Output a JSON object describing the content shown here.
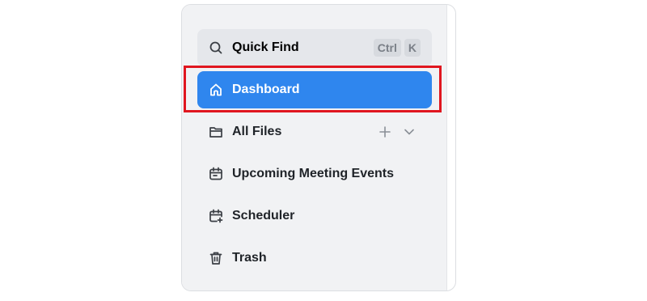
{
  "sidebar": {
    "quick_find": {
      "label": "Quick Find",
      "shortcut": [
        "Ctrl",
        "K"
      ]
    },
    "items": [
      {
        "label": "Dashboard",
        "icon": "home-icon",
        "active": true
      },
      {
        "label": "All Files",
        "icon": "folder-icon",
        "actions": [
          "plus-icon",
          "chevron-down-icon"
        ]
      },
      {
        "label": "Upcoming Meeting Events",
        "icon": "calendar-icon"
      },
      {
        "label": "Scheduler",
        "icon": "calendar-plus-icon"
      },
      {
        "label": "Trash",
        "icon": "trash-icon"
      }
    ]
  },
  "colors": {
    "active_bg": "#2f86ee",
    "sidebar_bg": "#f1f2f4",
    "highlight_border": "#e0161f"
  }
}
